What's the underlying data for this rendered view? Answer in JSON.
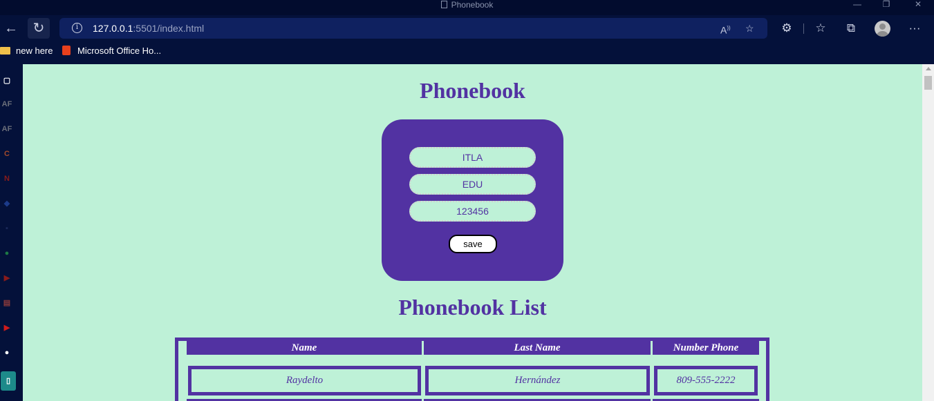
{
  "window": {
    "title": "Phonebook",
    "controls": {
      "minimize": "—",
      "restore": "❐",
      "close": "✕"
    }
  },
  "address_bar": {
    "url_host": "127.0.0.1",
    "url_rest": ":5501/index.html"
  },
  "bookmarks": [
    {
      "label": "new here",
      "icon": "folder-icon"
    },
    {
      "label": "Microsoft Office Ho...",
      "icon": "office-icon"
    }
  ],
  "sidebar": {
    "items": [
      {
        "icon": "tabs-icon",
        "glyph": "▢",
        "color": "#ffffff"
      },
      {
        "icon": "af-icon",
        "glyph": "AF",
        "color": "#6b6f7a"
      },
      {
        "icon": "af-icon",
        "glyph": "AF",
        "color": "#6b6f7a"
      },
      {
        "icon": "crunchyroll-icon",
        "glyph": "C",
        "color": "#a34a2a"
      },
      {
        "icon": "netflix-icon",
        "glyph": "N",
        "color": "#8a1b1b"
      },
      {
        "icon": "app-icon",
        "glyph": "◆",
        "color": "#1c3b8a"
      },
      {
        "icon": "app-icon",
        "glyph": "▪",
        "color": "#1c2a5a"
      },
      {
        "icon": "spotify-icon",
        "glyph": "●",
        "color": "#1d7a45"
      },
      {
        "icon": "youtube-icon",
        "glyph": "▶",
        "color": "#8a1b1b"
      },
      {
        "icon": "pdf-icon",
        "glyph": "▤",
        "color": "#8a3a3a"
      },
      {
        "icon": "youtube-icon",
        "glyph": "▶",
        "color": "#d01b1b"
      },
      {
        "icon": "github-icon",
        "glyph": "●",
        "color": "#ffffff"
      },
      {
        "icon": "document-icon",
        "glyph": "▯",
        "color": "#1d8a8a"
      }
    ]
  },
  "page": {
    "title": "Phonebook",
    "form": {
      "name_value": "ITLA",
      "lastname_value": "EDU",
      "phone_value": "123456",
      "save_label": "save"
    },
    "list_title": "Phonebook List",
    "table": {
      "headers": [
        "Name",
        "Last Name",
        "Number Phone"
      ],
      "rows": [
        [
          "Raydelto",
          "Hernández",
          "809-555-2222"
        ]
      ]
    }
  },
  "colors": {
    "accent": "#5232a2",
    "page_bg": "#bef1d7",
    "browser_bg": "#04113a"
  }
}
